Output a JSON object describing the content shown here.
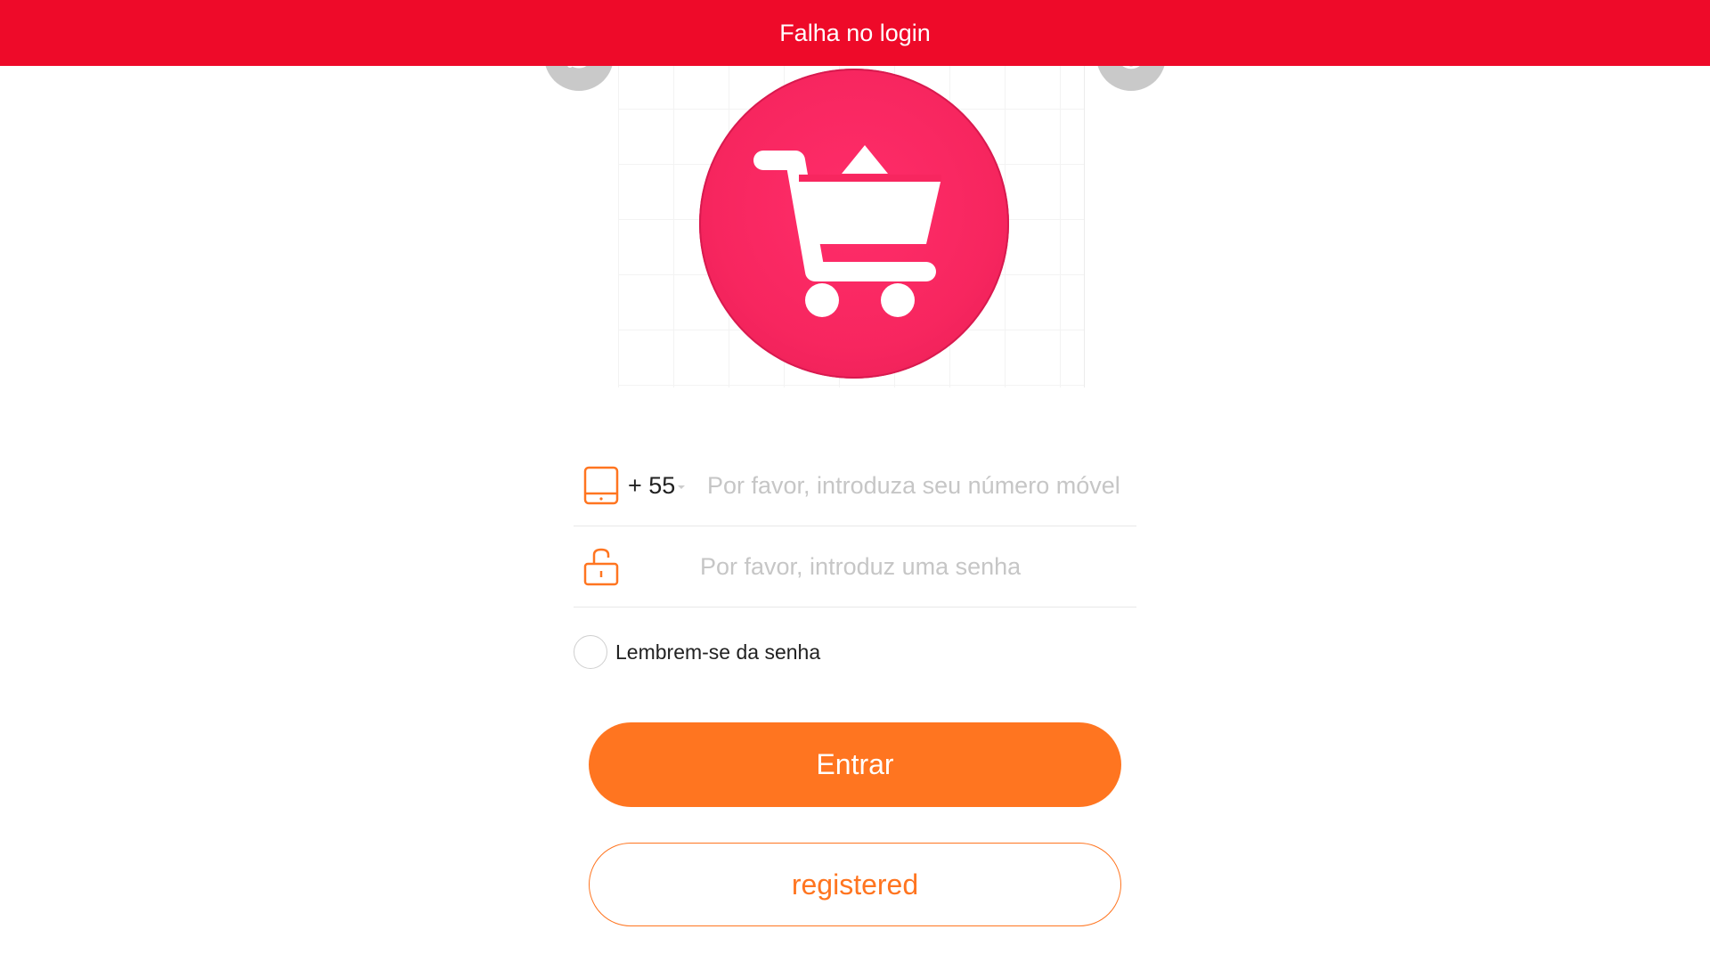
{
  "banner": {
    "message": "Falha no login"
  },
  "header": {
    "left_icon": "headset-support-icon",
    "right_icon": "globe-language-icon"
  },
  "logo": {
    "icon": "shopping-cart-icon",
    "color": "#f7265f"
  },
  "form": {
    "phone": {
      "icon": "mobile-phone-icon",
      "country_code": "+ 55",
      "placeholder": "Por favor, introduza seu número móvel",
      "value": ""
    },
    "password": {
      "icon": "lock-icon",
      "placeholder": "Por favor, introduz uma senha",
      "value": ""
    },
    "remember": {
      "label": "Lembrem-se da senha",
      "checked": false
    }
  },
  "buttons": {
    "login_label": "Entrar",
    "register_label": "registered"
  },
  "colors": {
    "banner": "#ee0a29",
    "accent": "#ff7520",
    "logo": "#f7265f"
  }
}
